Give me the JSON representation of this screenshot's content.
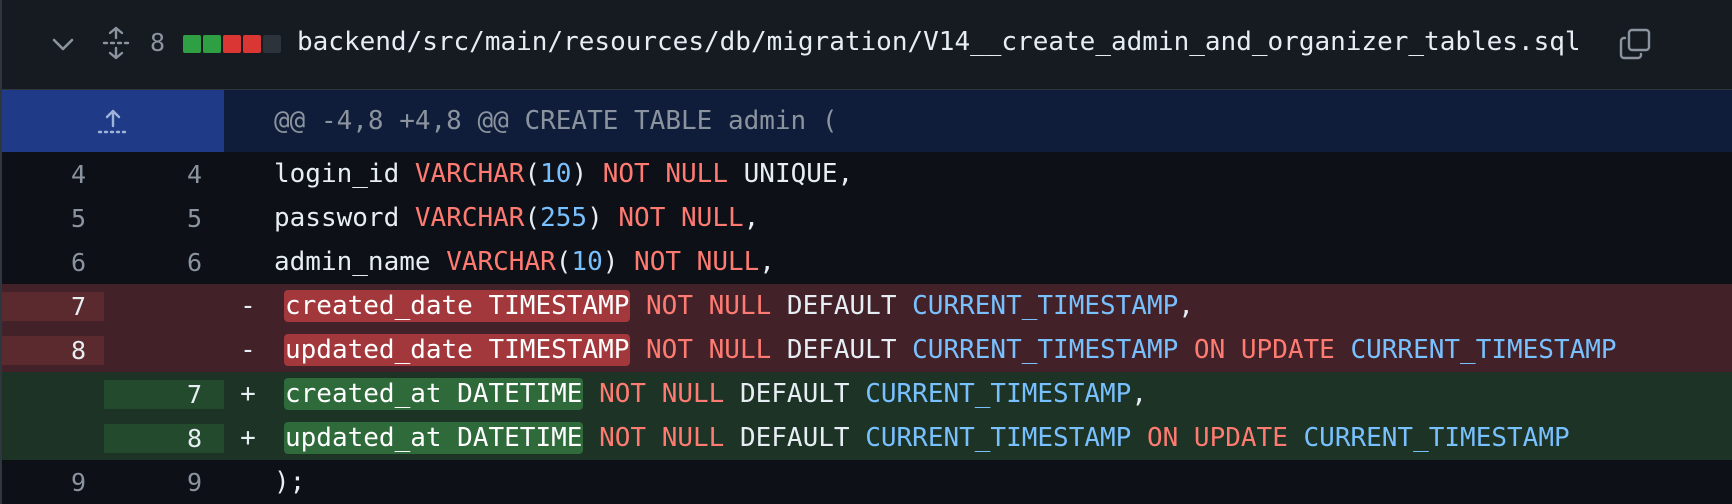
{
  "file": {
    "changes_count": "8",
    "stat_colors": [
      "#2ea043",
      "#2ea043",
      "#da3633",
      "#da3633",
      "#2d333b"
    ],
    "path": "backend/src/main/resources/db/migration/V14__create_admin_and_organizer_tables.sql",
    "icons": {
      "collapse": "chevron-down-icon",
      "expand": "unfold-icon",
      "copy": "copy-icon",
      "expand_up": "expand-up-icon"
    }
  },
  "hunk": {
    "header": "@@ -4,8 +4,8 @@ CREATE TABLE admin ("
  },
  "lines": [
    {
      "old": "4",
      "new": "4",
      "sign": "",
      "type": "ctx",
      "t": [
        "login_id ",
        "VARCHAR",
        "(",
        "10",
        ") ",
        "NOT NULL",
        " UNIQUE,"
      ]
    },
    {
      "old": "5",
      "new": "5",
      "sign": "",
      "type": "ctx",
      "t": [
        "password ",
        "VARCHAR",
        "(",
        "255",
        ") ",
        "NOT NULL",
        ","
      ]
    },
    {
      "old": "6",
      "new": "6",
      "sign": "",
      "type": "ctx",
      "t": [
        "admin_name ",
        "VARCHAR",
        "(",
        "10",
        ") ",
        "NOT NULL",
        ","
      ]
    },
    {
      "old": "7",
      "new": "",
      "sign": "-",
      "type": "del",
      "t": [
        "created_date TIMESTAMP",
        " ",
        "NOT NULL",
        " DEFAULT ",
        "CURRENT_TIMESTAMP",
        ","
      ]
    },
    {
      "old": "8",
      "new": "",
      "sign": "-",
      "type": "del",
      "t": [
        "updated_date TIMESTAMP",
        " ",
        "NOT NULL",
        " DEFAULT ",
        "CURRENT_TIMESTAMP",
        " ",
        "ON UPDATE",
        " ",
        "CURRENT_TIMESTAMP"
      ]
    },
    {
      "old": "",
      "new": "7",
      "sign": "+",
      "type": "add",
      "t": [
        "created_at DATETIME",
        " ",
        "NOT NULL",
        " DEFAULT ",
        "CURRENT_TIMESTAMP",
        ","
      ]
    },
    {
      "old": "",
      "new": "8",
      "sign": "+",
      "type": "add",
      "t": [
        "updated_at DATETIME",
        " ",
        "NOT NULL",
        " DEFAULT ",
        "CURRENT_TIMESTAMP",
        " ",
        "ON UPDATE",
        " ",
        "CURRENT_TIMESTAMP"
      ]
    },
    {
      "old": "9",
      "new": "9",
      "sign": "",
      "type": "ctx",
      "t": [
        ");"
      ]
    }
  ]
}
